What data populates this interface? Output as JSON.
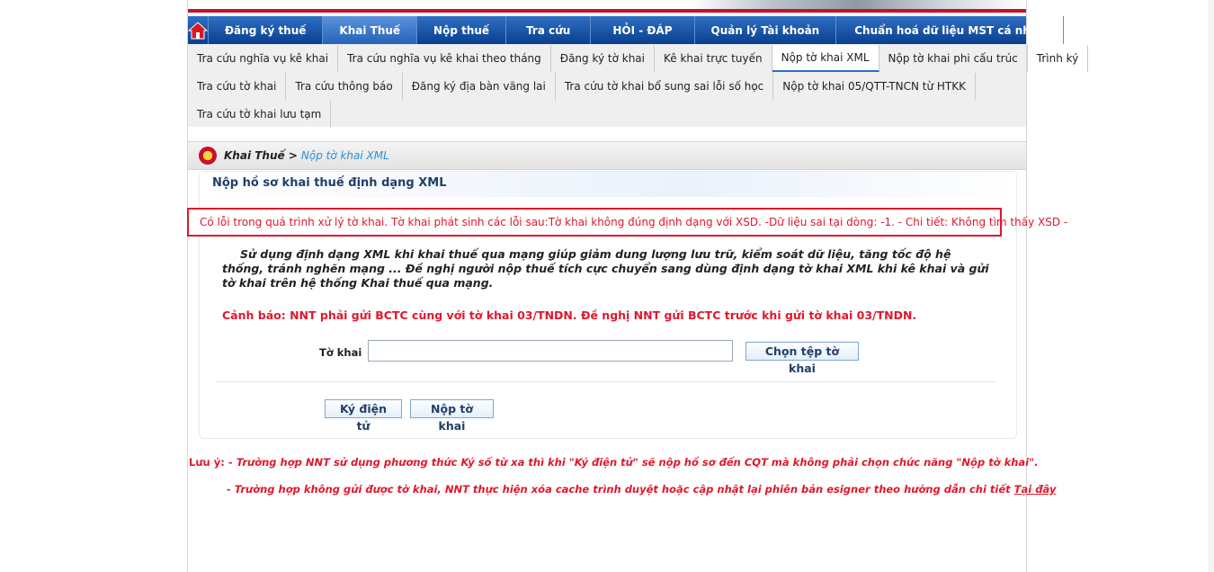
{
  "menu": {
    "home_icon": "home-icon",
    "items": [
      {
        "label": "Đăng ký thuế",
        "active": false
      },
      {
        "label": "Khai Thuế",
        "active": true
      },
      {
        "label": "Nộp thuế",
        "active": false
      },
      {
        "label": "Tra cứu",
        "active": false
      },
      {
        "label": "HỎI - ĐÁP",
        "active": false
      },
      {
        "label": "Quản lý Tài khoản",
        "active": false
      },
      {
        "label": "Chuẩn hoá dữ liệu MST cá nhân",
        "active": false
      }
    ]
  },
  "submenu": {
    "row1": [
      "Tra cứu nghĩa vụ kê khai",
      "Tra cứu nghĩa vụ kê khai theo tháng",
      "Đăng ký tờ khai",
      "Kê khai trực tuyến",
      "Nộp tờ khai XML",
      "Nộp tờ khai phi cấu trúc",
      "Trình ký"
    ],
    "row2": [
      "Tra cứu tờ khai",
      "Tra cứu thông báo",
      "Đăng ký địa bàn vãng lai",
      "Tra cứu tờ khai bổ sung sai lỗi số học",
      "Nộp tờ khai 05/QTT-TNCN từ HTKK"
    ],
    "row3": [
      "Tra cứu tờ khai lưu tạm"
    ],
    "active": "Nộp tờ khai XML"
  },
  "breadcrumb": {
    "parent": "Khai Thuế >",
    "current": "Nộp tờ khai XML"
  },
  "page_title": "Nộp hồ sơ khai thuế định dạng XML",
  "error_message": "Có lỗi trong quá trình xử lý tờ khai. Tờ khai phát sinh các lỗi sau:Tờ khai không đúng định dạng với XSD. -Dữ liệu sai tại dòng: -1. - Chi tiết: Không tìm thấy XSD -",
  "intro_text": "Sử dụng định dạng XML khi khai thuế qua mạng giúp giảm dung lượng lưu trữ, kiểm soát dữ liệu, tăng tốc độ hệ thống, tránh nghẽn mạng ... Đề nghị người nộp thuế tích cực chuyển sang dùng định dạng tờ khai XML khi kê khai và gửi tờ khai trên hệ thống Khai thuế qua mạng.",
  "warning_text": "Cảnh báo: NNT phải gửi BCTC cùng với tờ khai 03/TNDN. Đề nghị NNT gửi BCTC trước khi gửi tờ khai 03/TNDN.",
  "form": {
    "file_label": "Tờ khai",
    "file_value": "",
    "choose_file_label": "Chọn tệp tờ khai",
    "sign_label": "Ký điện tử",
    "submit_label": "Nộp tờ khai"
  },
  "notes": {
    "label": "Lưu ý:",
    "note1": "- Trường hợp NNT sử dụng phương thức Ký số từ xa thì khi \"Ký điện tử\" sẽ nộp hồ sơ đến CQT mà không phải chọn chức năng \"Nộp tờ khai\".",
    "note2_prefix": "- Trường hợp không gửi được tờ khai, NNT thực hiện xóa cache trình duyệt hoặc cập nhật lại phiên bản esigner theo hướng dẫn chi tiết",
    "note2_link": "Tại đây"
  },
  "colors": {
    "menu_blue": "#0a3f8f",
    "accent_red": "#e0182d",
    "link_blue": "#2d8fd8"
  }
}
